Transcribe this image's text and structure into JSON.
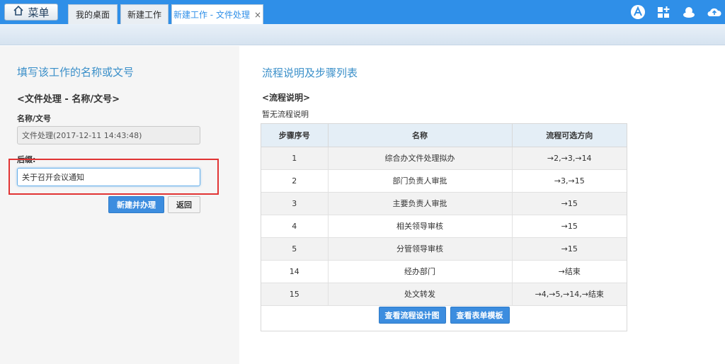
{
  "topbar": {
    "menu_label": "菜单",
    "tabs": [
      {
        "label": "我的桌面"
      },
      {
        "label": "新建工作"
      },
      {
        "label": "新建工作 - 文件处理",
        "close": "×"
      }
    ]
  },
  "left": {
    "title": "填写该工作的名称或文号",
    "form_subtitle": "<文件处理 - 名称/文号>",
    "name_label": "名称/文号",
    "name_value": "文件处理(2017-12-11 14:43:48)",
    "extra_label": "后缀:",
    "extra_value": "关于召开会议通知",
    "submit_label": "新建并办理",
    "back_label": "返回"
  },
  "right": {
    "title": "流程说明及步骤列表",
    "desc_heading": "<流程说明>",
    "desc_text": "暂无流程说明",
    "table": {
      "headers": [
        "步骤序号",
        "名称",
        "流程可选方向"
      ],
      "rows": [
        [
          "1",
          "综合办文件处理拟办",
          "→2,→3,→14"
        ],
        [
          "2",
          "部门负责人审批",
          "→3,→15"
        ],
        [
          "3",
          "主要负责人审批",
          "→15"
        ],
        [
          "4",
          "相关领导审核",
          "→15"
        ],
        [
          "5",
          "分管领导审核",
          "→15"
        ],
        [
          "14",
          "经办部门",
          "→结束"
        ],
        [
          "15",
          "处文转发",
          "→4,→5,→14,→结束"
        ]
      ]
    },
    "btn_design": "查看流程设计图",
    "btn_form": "查看表单模板"
  },
  "colors": {
    "topbar": "#2f8fe8",
    "title": "#3a8fc9",
    "primary_button": "#3c8ddf",
    "highlight": "#e13434"
  }
}
